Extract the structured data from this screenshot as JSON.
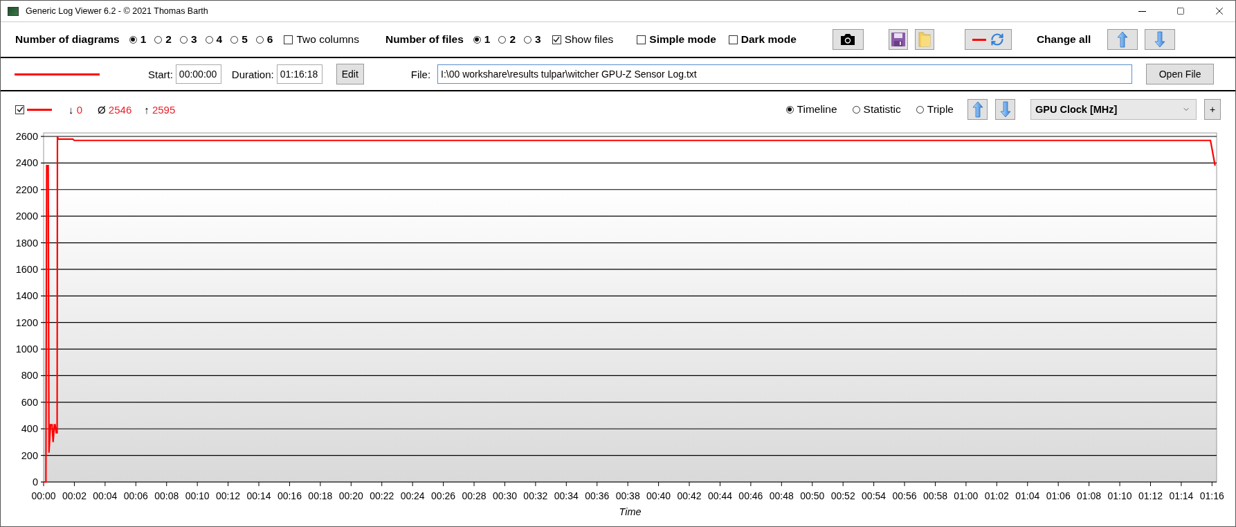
{
  "window": {
    "title": "Generic Log Viewer 6.2 - © 2021 Thomas Barth"
  },
  "toolbar": {
    "diagrams_label": "Number of diagrams",
    "diagram_options": [
      {
        "label": "1",
        "selected": true
      },
      {
        "label": "2",
        "selected": false
      },
      {
        "label": "3",
        "selected": false
      },
      {
        "label": "4",
        "selected": false
      },
      {
        "label": "5",
        "selected": false
      },
      {
        "label": "6",
        "selected": false
      }
    ],
    "two_columns": {
      "label": "Two columns",
      "checked": false
    },
    "files_label": "Number of files",
    "file_options": [
      {
        "label": "1",
        "selected": true
      },
      {
        "label": "2",
        "selected": false
      },
      {
        "label": "3",
        "selected": false
      }
    ],
    "show_files": {
      "label": "Show files",
      "checked": true
    },
    "simple_mode": {
      "label": "Simple mode",
      "checked": false
    },
    "dark_mode": {
      "label": "Dark mode",
      "checked": false
    },
    "change_all_label": "Change all"
  },
  "file_row": {
    "start_label": "Start:",
    "start_value": "00:00:00",
    "duration_label": "Duration:",
    "duration_value": "01:16:18",
    "edit_button": "Edit",
    "file_label": "File:",
    "file_value": "I:\\00 workshare\\results tulpar\\witcher GPU-Z Sensor Log.txt",
    "open_button": "Open File"
  },
  "diagram": {
    "visible": true,
    "min_symbol": "↓",
    "min": "0",
    "avg_symbol": "Ø",
    "avg": "2546",
    "max_symbol": "↑",
    "max": "2595",
    "views": [
      {
        "label": "Timeline",
        "selected": true
      },
      {
        "label": "Statistic",
        "selected": false
      },
      {
        "label": "Triple",
        "selected": false
      }
    ],
    "add_button": "+",
    "chart_data": {
      "type": "line",
      "xlabel": "Time",
      "grid": true,
      "x": [
        0,
        0.15,
        0.2,
        0.3,
        0.35,
        0.45,
        0.55,
        0.62,
        0.7,
        0.75,
        0.82,
        0.88,
        0.9,
        0.95,
        1.0,
        1.9,
        2.0,
        75.9,
        76.2
      ],
      "series": [
        {
          "name": "GPU Clock [MHz]",
          "color": "#ff0000",
          "values": [
            0,
            0,
            2380,
            2380,
            220,
            430,
            430,
            300,
            430,
            430,
            370,
            370,
            2600,
            2580,
            2580,
            2580,
            2570,
            2570,
            2380
          ]
        }
      ],
      "xlim": [
        0,
        76.3
      ],
      "ylim": [
        0,
        2600
      ],
      "xticks": [
        {
          "value": 0,
          "label": "00:00"
        },
        {
          "value": 2,
          "label": "00:02"
        },
        {
          "value": 4,
          "label": "00:04"
        },
        {
          "value": 6,
          "label": "00:06"
        },
        {
          "value": 8,
          "label": "00:08"
        },
        {
          "value": 10,
          "label": "00:10"
        },
        {
          "value": 12,
          "label": "00:12"
        },
        {
          "value": 14,
          "label": "00:14"
        },
        {
          "value": 16,
          "label": "00:16"
        },
        {
          "value": 18,
          "label": "00:18"
        },
        {
          "value": 20,
          "label": "00:20"
        },
        {
          "value": 22,
          "label": "00:22"
        },
        {
          "value": 24,
          "label": "00:24"
        },
        {
          "value": 26,
          "label": "00:26"
        },
        {
          "value": 28,
          "label": "00:28"
        },
        {
          "value": 30,
          "label": "00:30"
        },
        {
          "value": 32,
          "label": "00:32"
        },
        {
          "value": 34,
          "label": "00:34"
        },
        {
          "value": 36,
          "label": "00:36"
        },
        {
          "value": 38,
          "label": "00:38"
        },
        {
          "value": 40,
          "label": "00:40"
        },
        {
          "value": 42,
          "label": "00:42"
        },
        {
          "value": 44,
          "label": "00:44"
        },
        {
          "value": 46,
          "label": "00:46"
        },
        {
          "value": 48,
          "label": "00:48"
        },
        {
          "value": 50,
          "label": "00:50"
        },
        {
          "value": 52,
          "label": "00:52"
        },
        {
          "value": 54,
          "label": "00:54"
        },
        {
          "value": 56,
          "label": "00:56"
        },
        {
          "value": 58,
          "label": "00:58"
        },
        {
          "value": 60,
          "label": "01:00"
        },
        {
          "value": 62,
          "label": "01:02"
        },
        {
          "value": 64,
          "label": "01:04"
        },
        {
          "value": 66,
          "label": "01:06"
        },
        {
          "value": 68,
          "label": "01:08"
        },
        {
          "value": 70,
          "label": "01:10"
        },
        {
          "value": 72,
          "label": "01:12"
        },
        {
          "value": 74,
          "label": "01:14"
        },
        {
          "value": 76,
          "label": "01:16"
        }
      ],
      "yticks": [
        0,
        200,
        400,
        600,
        800,
        1000,
        1200,
        1400,
        1600,
        1800,
        2000,
        2200,
        2400,
        2600
      ]
    }
  }
}
